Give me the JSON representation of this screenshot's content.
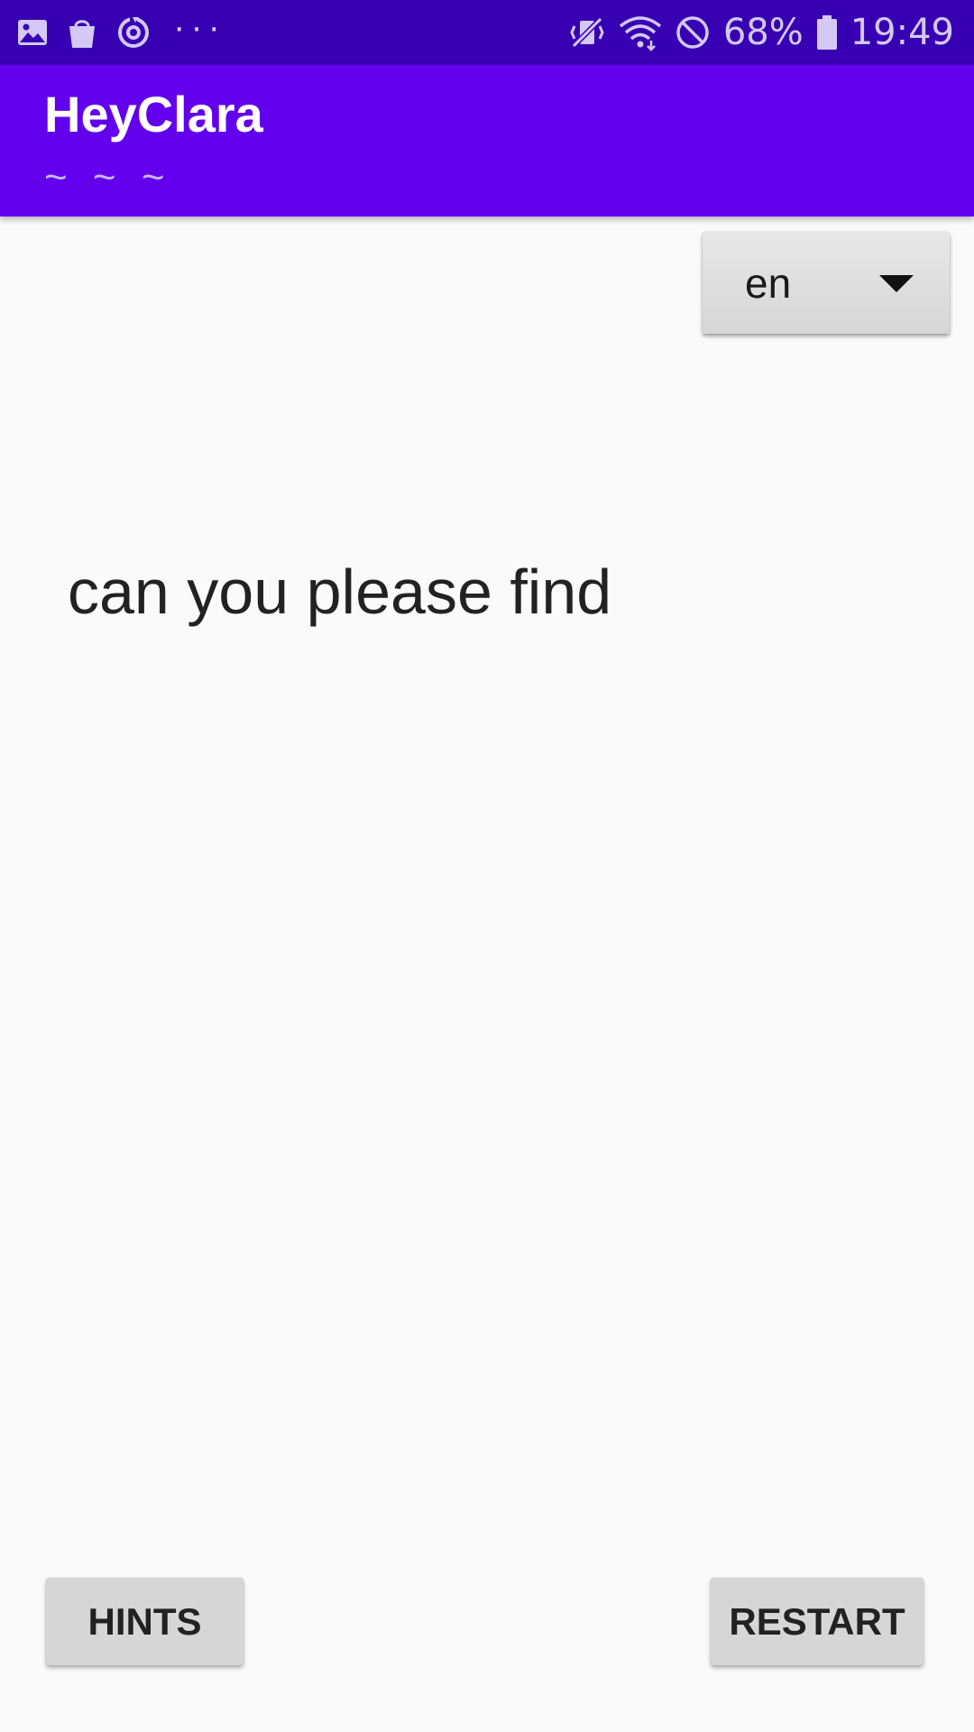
{
  "status_bar": {
    "left_icons": [
      "gallery-icon",
      "shopping-bag-icon",
      "sync-icon"
    ],
    "more_label": "···",
    "right_icons": [
      "vibrate-mute-icon",
      "wifi-icon",
      "do-not-disturb-icon",
      "battery-icon"
    ],
    "battery": "68%",
    "time": "19:49"
  },
  "app_bar": {
    "title": "HeyClara",
    "subtitle": "~ ~ ~"
  },
  "language_spinner": {
    "selected": "en",
    "icon": "dropdown-arrow-icon"
  },
  "main": {
    "phrase": "can you please find"
  },
  "buttons": {
    "hints": "HINTS",
    "restart": "RESTART"
  },
  "colors": {
    "status_bar": "#3700b3",
    "app_bar": "#6200ee",
    "background": "#fafafa",
    "button": "#d6d6d6"
  }
}
